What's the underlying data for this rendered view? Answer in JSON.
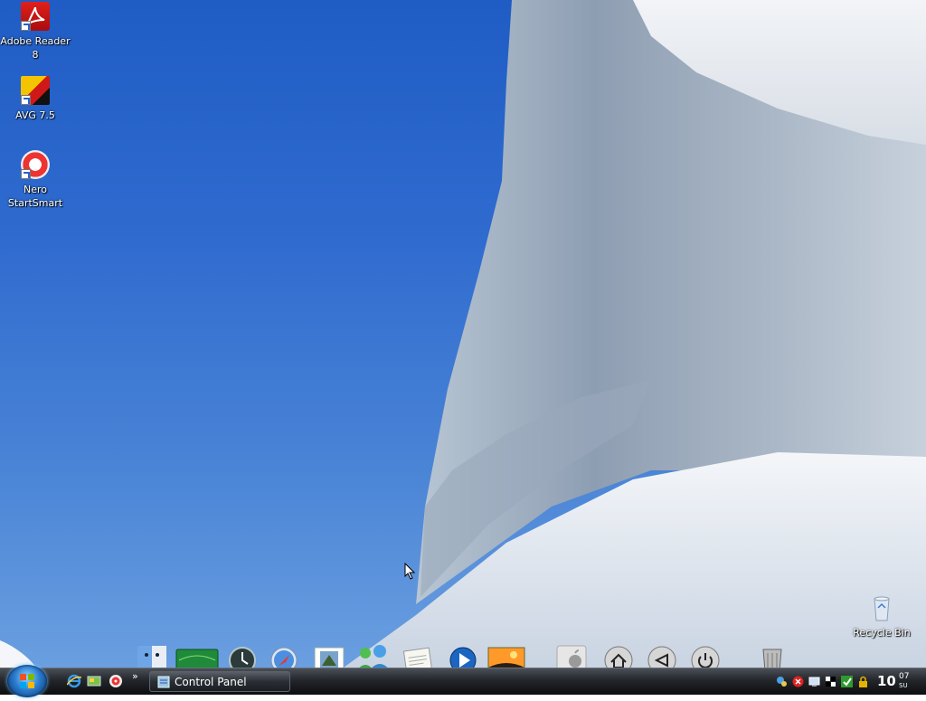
{
  "desktop": {
    "icons": [
      {
        "label": "Adobe Reader 8",
        "icon": "adobe-reader-icon"
      },
      {
        "label": "AVG 7.5",
        "icon": "avg-antivirus-icon"
      },
      {
        "label": "Nero StartSmart",
        "icon": "nero-icon"
      }
    ],
    "recycle_bin": {
      "label": "Recycle Bin",
      "icon": "recycle-bin-icon"
    }
  },
  "dock": {
    "items": [
      {
        "icon": "finder-icon"
      },
      {
        "icon": "dashboard-icon"
      },
      {
        "icon": "time-machine-icon"
      },
      {
        "icon": "safari-icon"
      },
      {
        "icon": "mail-icon"
      },
      {
        "icon": "messenger-icon"
      },
      {
        "icon": "textedit-icon"
      },
      {
        "icon": "media-player-icon"
      },
      {
        "icon": "photo-icon"
      },
      {
        "icon": "apple-icon"
      },
      {
        "icon": "home-icon"
      },
      {
        "icon": "back-icon"
      },
      {
        "icon": "power-icon"
      },
      {
        "icon": "trash-icon"
      }
    ]
  },
  "taskbar": {
    "start_icon": "windows-orb-icon",
    "quick_launch": [
      {
        "icon": "internet-explorer-icon"
      },
      {
        "icon": "show-desktop-icon"
      },
      {
        "icon": "nero-small-icon"
      }
    ],
    "overflow": "»",
    "task_button": {
      "label": "Control Panel",
      "icon": "control-panel-icon"
    },
    "tray_icons": [
      "network-icon",
      "shield-x-icon",
      "monitor-icon",
      "flag-icon",
      "check-icon",
      "lock-icon"
    ],
    "clock": {
      "hour": "10",
      "minute": "07",
      "day": "SU"
    }
  },
  "colors": {
    "sky": "#2f6bcf",
    "taskbar": "#1b1e22"
  }
}
